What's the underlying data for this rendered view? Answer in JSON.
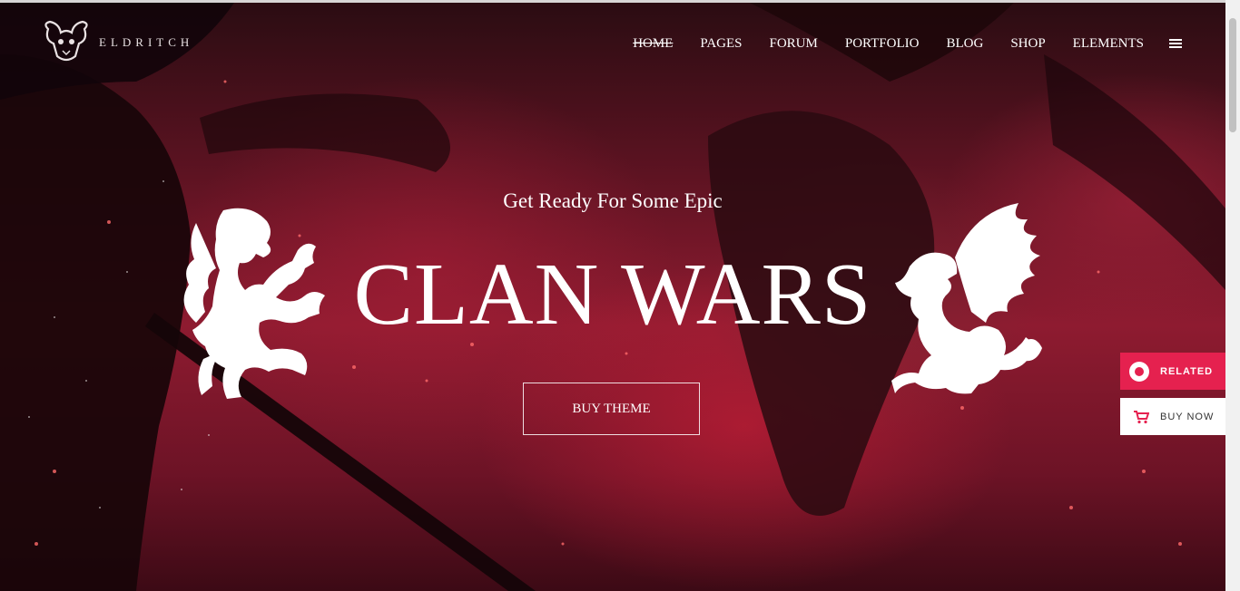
{
  "header": {
    "logo_text": "ELDRITCH",
    "nav": [
      {
        "label": "HOME"
      },
      {
        "label": "PAGES"
      },
      {
        "label": "FORUM"
      },
      {
        "label": "PORTFOLIO"
      },
      {
        "label": "BLOG"
      },
      {
        "label": "SHOP"
      },
      {
        "label": "ELEMENTS"
      }
    ],
    "menu_icon": "hamburger-icon"
  },
  "hero": {
    "tagline": "Get Ready For Some Epic",
    "headline": "CLAN WARS",
    "cta_label": "BUY THEME",
    "left_crest_icon": "lion-crest-icon",
    "right_crest_icon": "griffin-crest-icon"
  },
  "side_widgets": {
    "related_label": "RELATED",
    "related_icon": "related-icon",
    "buy_now_label": "BUY NOW",
    "buy_now_icon": "cart-icon"
  },
  "colors": {
    "accent": "#e5214f",
    "hero_red": "#8e1b30",
    "text": "#ffffff"
  }
}
